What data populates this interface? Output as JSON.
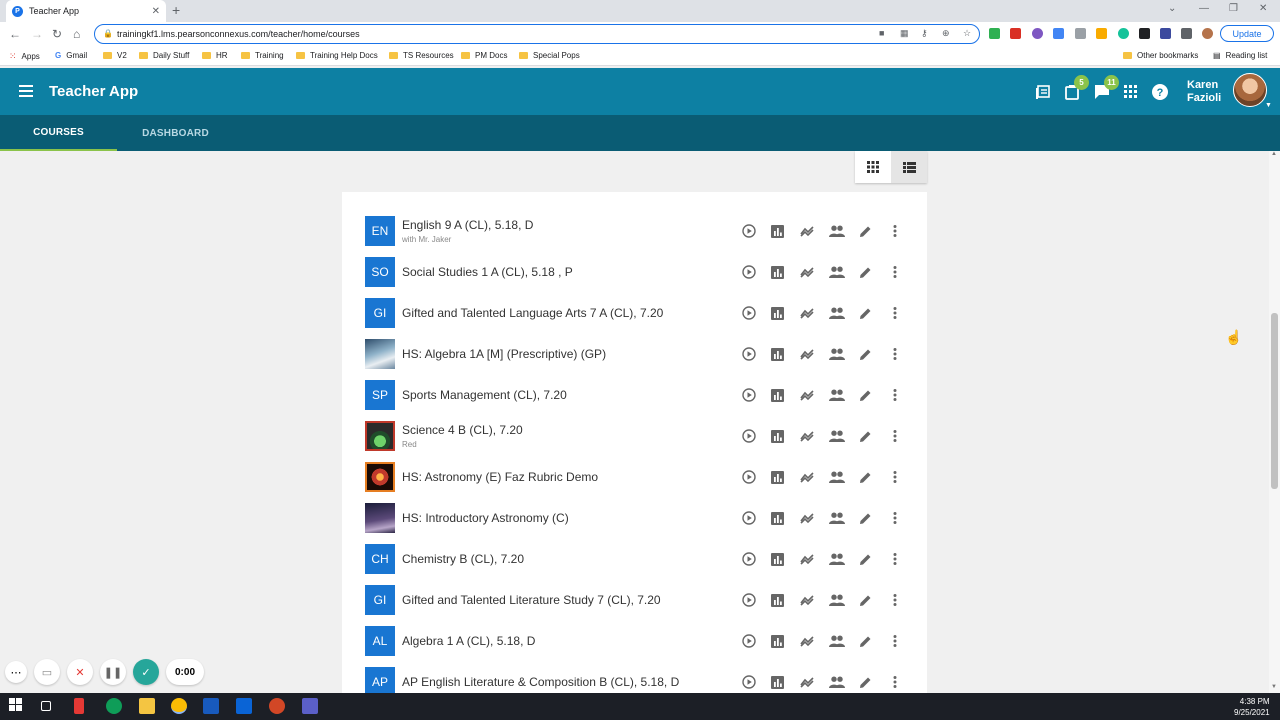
{
  "browser": {
    "tab_title": "Teacher App",
    "url": "trainingkf1.lms.pearsonconnexus.com/teacher/home/courses",
    "update_label": "Update",
    "bookmarks": [
      "Apps",
      "Gmail",
      "V2",
      "Daily Stuff",
      "HR",
      "Training",
      "Training Help Docs",
      "TS Resources",
      "PM Docs",
      "Special Pops"
    ],
    "other_bookmarks": "Other bookmarks",
    "reading_list": "Reading list"
  },
  "app": {
    "title": "Teacher App",
    "user_first": "Karen",
    "user_last": "Fazioli",
    "notifications_badge": "5",
    "messages_badge": "11",
    "tabs": [
      "COURSES",
      "DASHBOARD"
    ]
  },
  "courses": [
    {
      "tile": "EN",
      "title": "English 9 A (CL), 5.18, D",
      "subtitle": "with Mr. Jaker"
    },
    {
      "tile": "SO",
      "title": "Social Studies 1 A (CL), 5.18 , P",
      "subtitle": ""
    },
    {
      "tile": "GI",
      "title": "Gifted and Talented Language Arts 7 A (CL), 7.20",
      "subtitle": ""
    },
    {
      "tile": "",
      "image": "algebra-course-image",
      "title": "HS: Algebra 1A [M] (Prescriptive) (GP)",
      "subtitle": ""
    },
    {
      "tile": "SP",
      "title": "Sports Management (CL), 7.20",
      "subtitle": ""
    },
    {
      "tile": "",
      "image": "science-course-image",
      "title": "Science 4 B (CL), 7.20",
      "subtitle": "Red"
    },
    {
      "tile": "",
      "image": "astronomy-course-image",
      "title": "HS: Astronomy (E) Faz Rubric Demo",
      "subtitle": ""
    },
    {
      "tile": "",
      "image": "intro-astronomy-course-image",
      "title": "HS: Introductory Astronomy (C)",
      "subtitle": ""
    },
    {
      "tile": "CH",
      "title": "Chemistry B (CL), 7.20",
      "subtitle": ""
    },
    {
      "tile": "GI",
      "title": "Gifted and Talented Literature Study 7 (CL), 7.20",
      "subtitle": ""
    },
    {
      "tile": "AL",
      "title": "Algebra 1 A (CL), 5.18, D",
      "subtitle": ""
    },
    {
      "tile": "AP",
      "title": "AP English Literature & Composition B (CL), 5.18, D",
      "subtitle": ""
    }
  ],
  "recorder": {
    "time": "0:00"
  },
  "clock": {
    "time": "4:38 PM",
    "date": "9/25/2021"
  },
  "colors": {
    "app_bar": "#0d80a3",
    "tabs_bar": "#0a5c74",
    "tile": "#1976d2",
    "badge": "#8bc34a"
  }
}
